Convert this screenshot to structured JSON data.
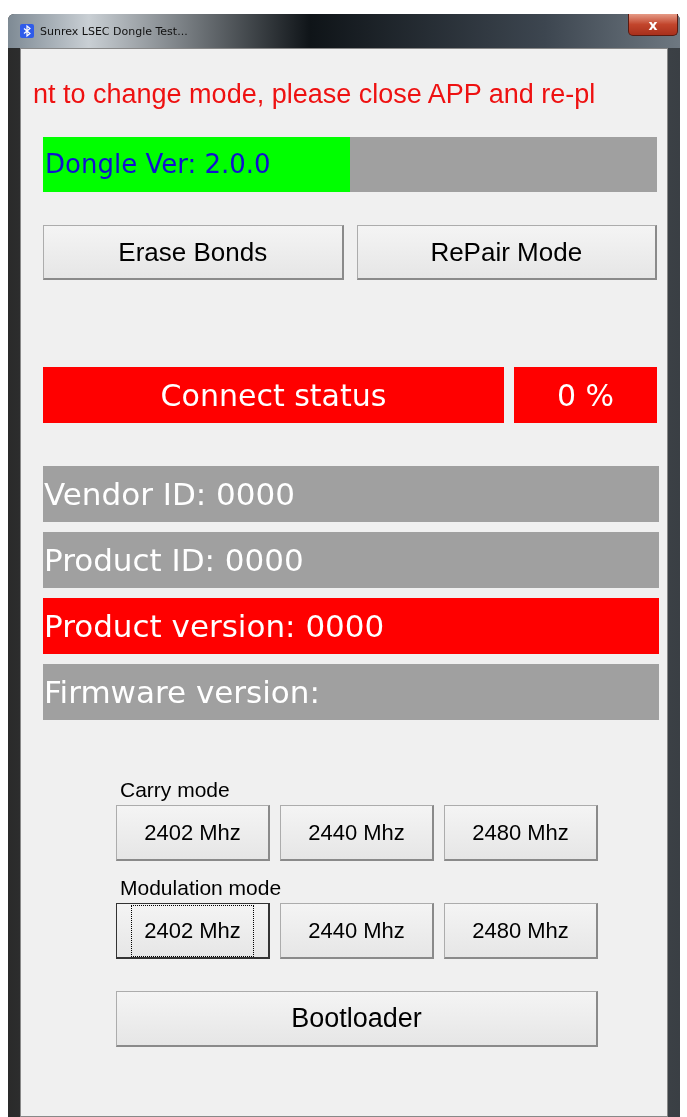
{
  "window": {
    "title": "Sunrex LSEC Dongle Test...",
    "close": "x"
  },
  "message": "nt to change mode, please close APP and re-pl",
  "dongle": {
    "label": "Dongle Ver: 2.0.0",
    "level": 0.5
  },
  "top_buttons": [
    "Erase Bonds",
    "RePair Mode"
  ],
  "connect": [
    {
      "text": "Connect status",
      "color": "#ff0000"
    },
    {
      "text": "0 %",
      "color": "#ff0000"
    }
  ],
  "info": [
    {
      "text": "Vendor ID: 0000",
      "color": "#a0a0a0"
    },
    {
      "text": "Product ID: 0000",
      "color": "#a0a0a0"
    },
    {
      "text": "Product version: 0000",
      "color": "#ff0000"
    },
    {
      "text": "Firmware version:",
      "color": "#a0a0a0"
    }
  ],
  "groups": [
    {
      "label": "Carry mode",
      "buttons": [
        {
          "label": "2402 Mhz",
          "focused": false
        },
        {
          "label": "2440 Mhz",
          "focused": false
        },
        {
          "label": "2480 Mhz",
          "focused": false
        }
      ]
    },
    {
      "label": "Modulation mode",
      "buttons": [
        {
          "label": "2402 Mhz",
          "focused": true
        },
        {
          "label": "2440 Mhz",
          "focused": false
        },
        {
          "label": "2480 Mhz",
          "focused": false
        }
      ]
    }
  ],
  "bootloader": "Bootloader"
}
